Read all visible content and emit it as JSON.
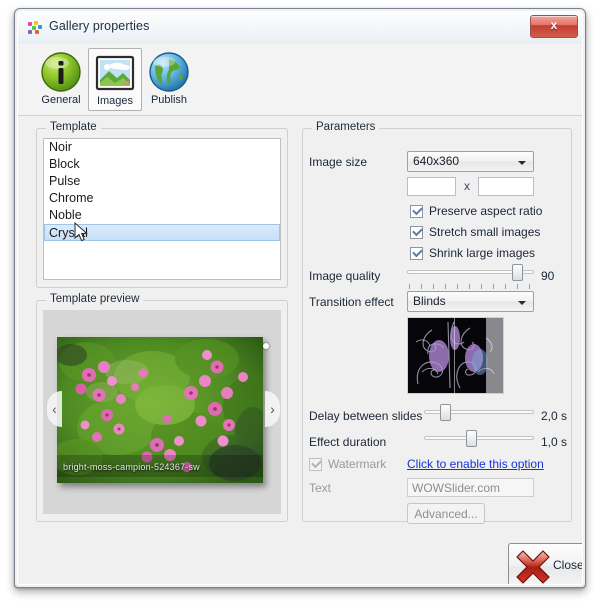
{
  "window": {
    "title": "Gallery properties",
    "close_label": "x",
    "icon": "gallery-icon"
  },
  "tabs": [
    {
      "label": "General",
      "icon": "info-icon",
      "selected": false
    },
    {
      "label": "Images",
      "icon": "picture-icon",
      "selected": true
    },
    {
      "label": "Publish",
      "icon": "globe-icon",
      "selected": false
    }
  ],
  "template_group": {
    "title": "Template",
    "items": [
      "Noir",
      "Block",
      "Pulse",
      "Chrome",
      "Noble",
      "Crystal"
    ],
    "selected": "Crystal",
    "selected_index": 5
  },
  "preview_group": {
    "title": "Template preview",
    "caption": "bright-moss-campion-524367-sw",
    "prev_arrow": "‹",
    "next_arrow": "›"
  },
  "parameters": {
    "title": "Parameters",
    "image_size": {
      "label": "Image size",
      "value": "640x360",
      "options": [
        "640x360"
      ],
      "width_value": "",
      "height_value": "",
      "separator": "x"
    },
    "checkboxes": [
      {
        "label": "Preserve aspect ratio",
        "checked": true,
        "enabled": true
      },
      {
        "label": "Stretch small images",
        "checked": true,
        "enabled": true
      },
      {
        "label": "Shrink large images",
        "checked": true,
        "enabled": true
      }
    ],
    "image_quality": {
      "label": "Image quality",
      "value": "90",
      "min": 0,
      "max": 100,
      "percent": 88,
      "tick_count": 11
    },
    "transition_effect": {
      "label": "Transition effect",
      "value": "Blinds",
      "options": [
        "Blinds"
      ]
    },
    "delay_between_slides": {
      "label": "Delay between slides",
      "value": "2,0 s",
      "percent": 16
    },
    "effect_duration": {
      "label": "Effect duration",
      "value": "1,0 s",
      "percent": 40
    },
    "watermark": {
      "label": "Watermark",
      "checked": true,
      "enabled": false,
      "link": "Click to enable this option"
    },
    "watermark_text": {
      "label": "Text",
      "value": "WOWSlider.com",
      "enabled": false
    },
    "advanced_button": {
      "label": "Advanced...",
      "enabled": false
    }
  },
  "footer": {
    "close_label": "Close",
    "close_icon": "red-x-icon"
  },
  "colors": {
    "accent_blue": "#1431d8",
    "selection": "#c8e0f7",
    "window_bg": "#f0f0f0",
    "close_red": "#c23f32"
  }
}
